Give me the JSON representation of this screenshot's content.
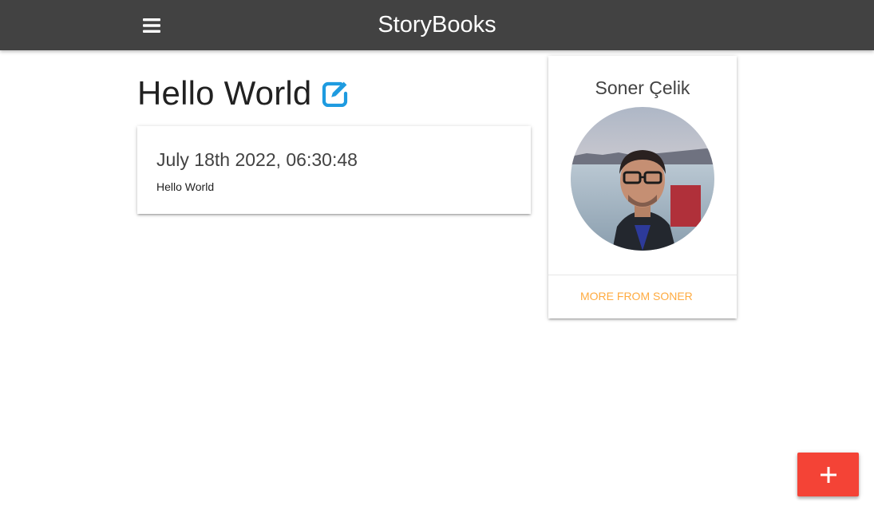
{
  "navbar": {
    "brand": "StoryBooks",
    "menu_icon": "hamburger-menu-icon",
    "background": "#424242"
  },
  "story": {
    "title": "Hello World",
    "edit_icon": "edit-icon",
    "date": "July 18th 2022, 06:30:48",
    "body": "Hello World"
  },
  "author": {
    "name": "Soner Çelik",
    "more_link": "MORE FROM SONER",
    "link_color": "#ffab40"
  },
  "fab": {
    "icon": "plus-icon",
    "color": "#f44336"
  },
  "colors": {
    "edit_icon": "#1e9be0"
  }
}
